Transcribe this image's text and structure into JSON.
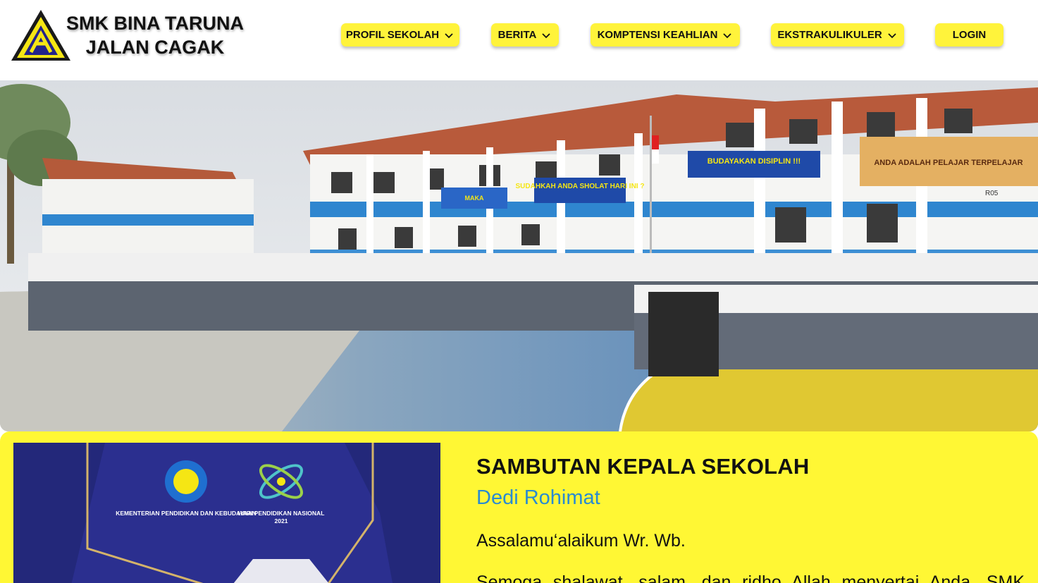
{
  "header": {
    "brand_line1": "SMK BINA TARUNA",
    "brand_line2": "JALAN CAGAK",
    "logo_icon": "school-triangle-logo",
    "nav": [
      {
        "label": "PROFIL SEKOLAH",
        "has_dropdown": true
      },
      {
        "label": "BERITA",
        "has_dropdown": true
      },
      {
        "label": "KOMPTENSI KEAHLIAN",
        "has_dropdown": true
      },
      {
        "label": "EKSTRAKULIKULER",
        "has_dropdown": true
      },
      {
        "label": "LOGIN",
        "has_dropdown": false
      }
    ]
  },
  "hero": {
    "banner_1": "SUDAHKAH ANDA SHOLAT HARI INI ?",
    "banner_2": "BUDAYAKAN DISIPLIN !!!",
    "banner_3": "MAKA",
    "banner_4": "ANDA ADALAH PELAJAR TERPELAJAR",
    "room_label": "R05"
  },
  "welcome": {
    "title": "SAMBUTAN KEPALA SEKOLAH",
    "name": "Dedi Rohimat",
    "greeting": "Assalamu‘alaikum Wr. Wb.",
    "body": "Semoga shalawat, salam, dan ridho Allah menyertai Anda. SMK",
    "poster_ministry": "KEMENTERIAN PENDIDIKAN DAN KEBUDAYAAN",
    "poster_event": "HARI PENDIDIKAN NASIONAL",
    "poster_year": "2021"
  },
  "colors": {
    "accent_yellow": "#fff734",
    "name_blue": "#2a8bd1",
    "poster_navy": "#2b2f8f"
  }
}
